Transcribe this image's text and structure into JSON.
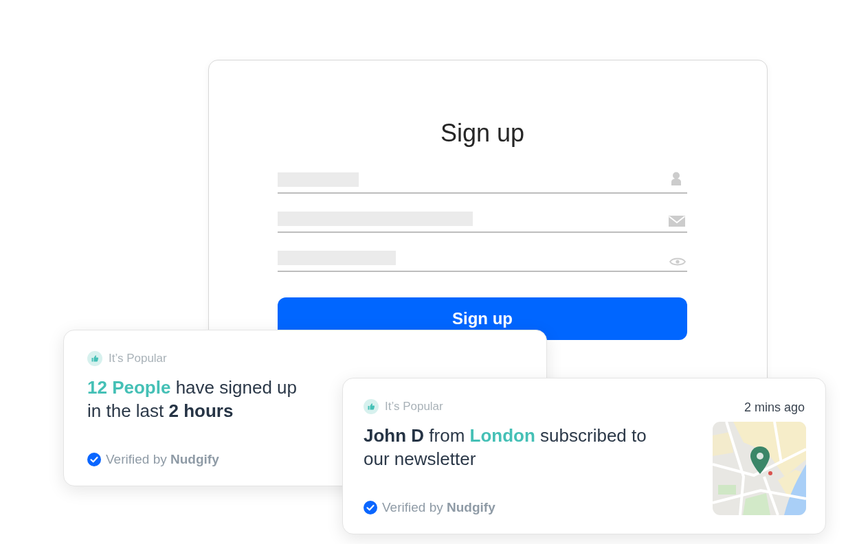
{
  "signup_form": {
    "title": "Sign up",
    "fields": [
      {
        "kind": "user"
      },
      {
        "kind": "email"
      },
      {
        "kind": "password"
      }
    ],
    "submit_button": "Sign up"
  },
  "notifications": [
    {
      "kind": "text",
      "badge": "It’s Popular",
      "message": [
        {
          "kind": "highlight",
          "text": "12 People"
        },
        {
          "kind": "plain",
          "text": " have signed up in the last "
        },
        {
          "kind": "strong",
          "text": "2 hours"
        }
      ],
      "verified": "Verified by **Nudgify**"
    },
    {
      "kind": "map",
      "badge": "It’s Popular",
      "time": "2 mins ago",
      "message": [
        {
          "kind": "strong",
          "text": "John D"
        },
        {
          "kind": "plain",
          "text": " from "
        },
        {
          "kind": "highlight",
          "text": "London"
        },
        {
          "kind": "plain",
          "text": " subscribed to our newsletter"
        }
      ],
      "verified": "Verified by **Nudgify**"
    }
  ]
}
